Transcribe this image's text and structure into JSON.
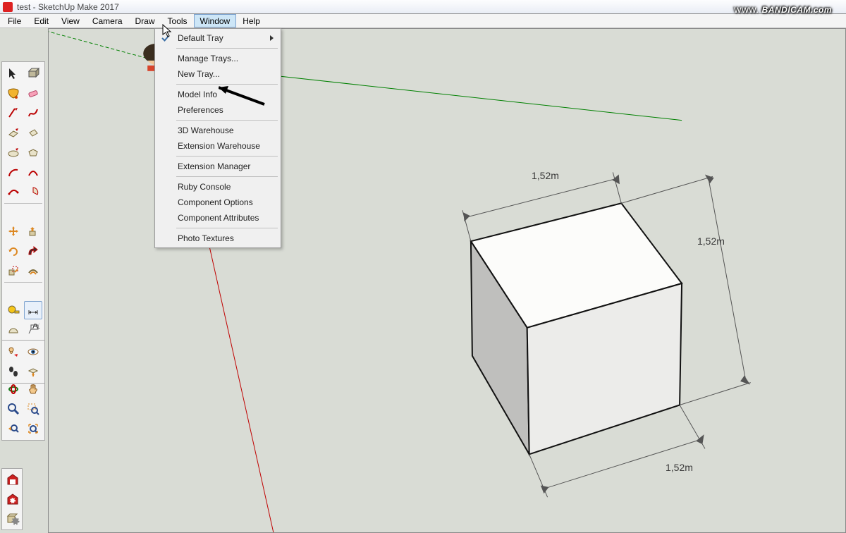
{
  "title": "test - SketchUp Make 2017",
  "watermark_prefix": "www.",
  "watermark_main": "BANDICAM.com",
  "menubar": [
    "File",
    "Edit",
    "View",
    "Camera",
    "Draw",
    "Tools",
    "Window",
    "Help"
  ],
  "menubar_open_index": 6,
  "window_menu": {
    "items": [
      {
        "label": "Default Tray",
        "checked": true,
        "submenu": true
      },
      {
        "sep": true
      },
      {
        "label": "Manage Trays..."
      },
      {
        "label": "New Tray..."
      },
      {
        "sep": true
      },
      {
        "label": "Model Info"
      },
      {
        "label": "Preferences"
      },
      {
        "sep": true
      },
      {
        "label": "3D Warehouse"
      },
      {
        "label": "Extension Warehouse"
      },
      {
        "sep": true
      },
      {
        "label": "Extension Manager"
      },
      {
        "sep": true
      },
      {
        "label": "Ruby Console"
      },
      {
        "label": "Component Options"
      },
      {
        "label": "Component Attributes"
      },
      {
        "sep": true
      },
      {
        "label": "Photo Textures"
      }
    ]
  },
  "dims": {
    "top": "1,52m",
    "right": "1,52m",
    "bottom": "1,52m"
  },
  "tool_names_1": [
    "select",
    "box",
    "paint",
    "eraser",
    "line",
    "freehand",
    "rectangle",
    "rot-rect",
    "circle",
    "polygon",
    "arc",
    "2pt-arc",
    "3pt-arc",
    "pie",
    "sep",
    "move",
    "push-pull",
    "rotate",
    "follow-me",
    "scale",
    "offset",
    "sep",
    "tape",
    "dimension",
    "protractor",
    "text",
    "axes",
    "3d-text",
    "sep",
    "orbit",
    "pan",
    "zoom",
    "zoom-window",
    "prev-view",
    "zoom-extents"
  ],
  "tool_names_2": [
    "position-camera",
    "look-around",
    "walk",
    "section",
    "sep",
    "warehouse",
    "extension",
    "layer"
  ]
}
